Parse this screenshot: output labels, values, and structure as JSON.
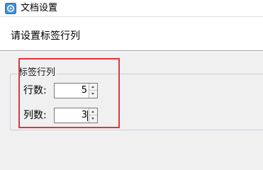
{
  "window": {
    "title": "文档设置",
    "icon": "app-logo-icon"
  },
  "header": {
    "title": "请设置标签行列"
  },
  "group": {
    "legend": "标签行列",
    "rows": {
      "label": "行数:",
      "value": "5"
    },
    "cols": {
      "label": "列数:",
      "value": "3"
    }
  },
  "colors": {
    "highlight": "#e5343a",
    "group_border": "#c8d0dc",
    "background": "#f0f0f0"
  }
}
